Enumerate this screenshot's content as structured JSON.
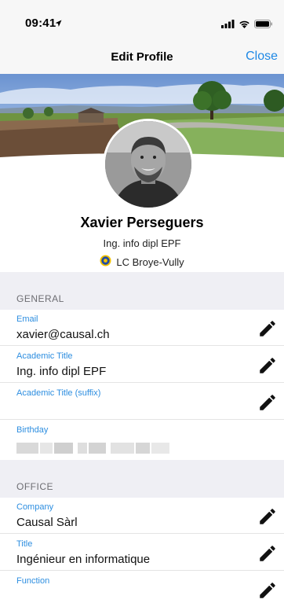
{
  "status": {
    "time": "09:41"
  },
  "nav": {
    "title": "Edit Profile",
    "close_label": "Close"
  },
  "profile": {
    "name": "Xavier Perseguers",
    "title": "Ing. info dipl EPF",
    "club": "LC Broye-Vully"
  },
  "sections": {
    "general": {
      "header": "GENERAL",
      "fields": [
        {
          "label": "Email",
          "value": "xavier@causal.ch"
        },
        {
          "label": "Academic Title",
          "value": "Ing. info dipl EPF"
        },
        {
          "label": "Academic Title (suffix)",
          "value": ""
        },
        {
          "label": "Birthday",
          "value": ""
        }
      ]
    },
    "office": {
      "header": "OFFICE",
      "fields": [
        {
          "label": "Company",
          "value": "Causal Sàrl"
        },
        {
          "label": "Title",
          "value": "Ingénieur en informatique"
        },
        {
          "label": "Function",
          "value": ""
        }
      ]
    }
  },
  "colors": {
    "accent": "#1e88e5",
    "label_blue": "#2d8ee0",
    "section_bg": "#efeff4"
  },
  "icons": [
    "location-arrow-icon",
    "signal-icon",
    "wifi-icon",
    "battery-icon",
    "lions-club-icon",
    "pencil-icon"
  ]
}
